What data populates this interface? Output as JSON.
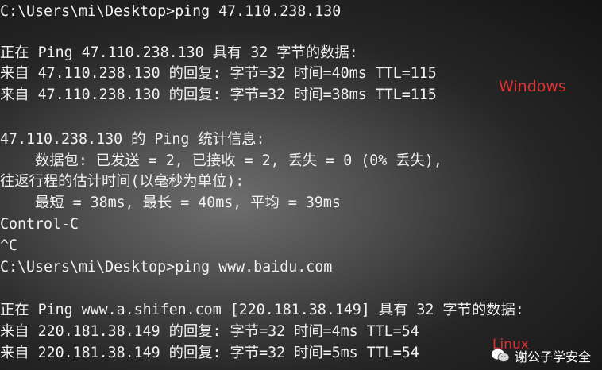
{
  "terminal": {
    "lines": [
      "C:\\Users\\mi\\Desktop>ping 47.110.238.130",
      "",
      "正在 Ping 47.110.238.130 具有 32 字节的数据:",
      "来自 47.110.238.130 的回复: 字节=32 时间=40ms TTL=115",
      "来自 47.110.238.130 的回复: 字节=32 时间=38ms TTL=115",
      "",
      "47.110.238.130 的 Ping 统计信息:",
      "    数据包: 已发送 = 2, 已接收 = 2, 丢失 = 0 (0% 丢失),",
      "往返行程的估计时间(以毫秒为单位):",
      "    最短 = 38ms, 最长 = 40ms, 平均 = 39ms",
      "Control-C",
      "^C",
      "C:\\Users\\mi\\Desktop>ping www.baidu.com",
      "",
      "正在 Ping www.a.shifen.com [220.181.38.149] 具有 32 字节的数据:",
      "来自 220.181.38.149 的回复: 字节=32 时间=4ms TTL=54",
      "来自 220.181.38.149 的回复: 字节=32 时间=5ms TTL=54"
    ]
  },
  "annotations": {
    "windows_label": "Windows",
    "linux_label": "Linux"
  },
  "watermark": {
    "text": "谢公子学安全",
    "icon": "wechat-icon"
  },
  "colors": {
    "terminal_text": "#f2f2f2",
    "annotation": "#e03030"
  }
}
